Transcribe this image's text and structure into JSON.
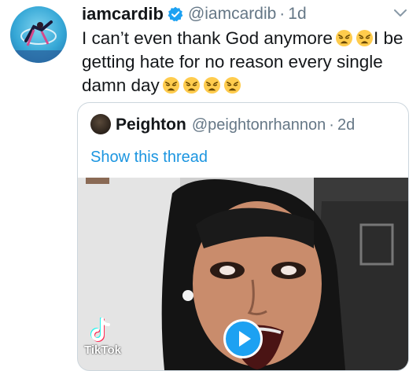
{
  "tweet": {
    "display_name": "iamcardib",
    "handle": "@iamcardib",
    "separator": "·",
    "time": "1d",
    "text_line1": "I can’t even thank God anymore",
    "text_line1_end": "I be",
    "text_line2": "getting hate for no reason every single",
    "text_line3": "damn day",
    "emoji_name": "weary-face"
  },
  "quoted_tweet": {
    "display_name": "Peighton",
    "handle": "@peightonrhannon",
    "separator": "·",
    "time": "2d",
    "thread_link": "Show this thread",
    "media": {
      "type": "video",
      "watermark": "TikTok"
    }
  },
  "colors": {
    "link_blue": "#1b95e0",
    "verified_blue": "#1da1f2",
    "secondary_text": "#657786",
    "border": "#ccd6dd"
  }
}
